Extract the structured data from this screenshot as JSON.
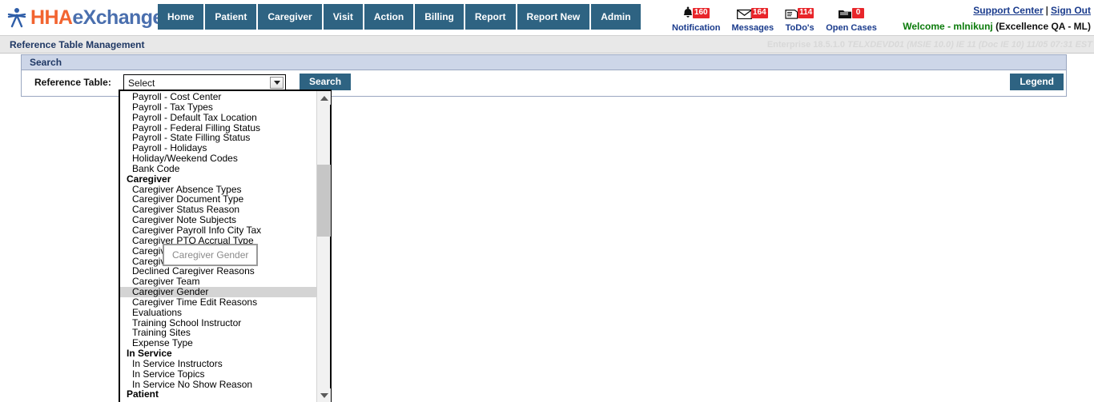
{
  "brand": {
    "logo_primary": "HHA",
    "logo_secondary": "eXchange",
    "color_orange": "#f26430",
    "color_blue": "#4a6fae"
  },
  "nav": {
    "items": [
      {
        "label": "Home",
        "name": "nav-home"
      },
      {
        "label": "Patient",
        "name": "nav-patient"
      },
      {
        "label": "Caregiver",
        "name": "nav-caregiver"
      },
      {
        "label": "Visit",
        "name": "nav-visit"
      },
      {
        "label": "Action",
        "name": "nav-action"
      },
      {
        "label": "Billing",
        "name": "nav-billing"
      },
      {
        "label": "Report",
        "name": "nav-report"
      },
      {
        "label": "Report New",
        "name": "nav-report-new"
      },
      {
        "label": "Admin",
        "name": "nav-admin"
      }
    ]
  },
  "alerts": [
    {
      "label": "Notification",
      "count": "160",
      "icon": "bell-icon",
      "glyph": "ὑ4"
    },
    {
      "label": "Messages",
      "count": "164",
      "icon": "envelope-icon",
      "glyph": "✉"
    },
    {
      "label": "ToDo's",
      "count": "114",
      "icon": "clipboard-icon",
      "glyph": "Ὕ2"
    },
    {
      "label": "Open Cases",
      "count": "0",
      "icon": "folder-icon",
      "glyph": "Ὄ1"
    }
  ],
  "topright": {
    "support_center": "Support Center",
    "separator": "|",
    "sign_out": "Sign Out",
    "welcome_user": "Welcome - mlnikunj",
    "welcome_org": "(Excellence QA - ML)"
  },
  "titlebar": {
    "page_title": "Reference Table Management",
    "enterprise_version": "Enterprise 18.5.1.0",
    "enterprise_env": "TELXDEVD01 (MSIE 10.0) IE 11 (Doc IE 10) 11/05 07:31 EST"
  },
  "search_panel": {
    "header": "Search",
    "field_label": "Reference Table:",
    "select_value": "Select",
    "search_button": "Search",
    "legend_button": "Legend"
  },
  "dropdown": {
    "selected_item": "Caregiver Gender",
    "tooltip_text": "Caregiver Gender",
    "options": [
      {
        "label": "Payroll - Cost Center",
        "type": "item"
      },
      {
        "label": "Payroll - Tax Types",
        "type": "item"
      },
      {
        "label": "Payroll - Default Tax Location",
        "type": "item"
      },
      {
        "label": "Payroll - Federal Filling Status",
        "type": "item"
      },
      {
        "label": "Payroll - State Filling Status",
        "type": "item"
      },
      {
        "label": "Payroll - Holidays",
        "type": "item"
      },
      {
        "label": "Holiday/Weekend Codes",
        "type": "item"
      },
      {
        "label": "Bank Code",
        "type": "item"
      },
      {
        "label": "Caregiver",
        "type": "group"
      },
      {
        "label": "Caregiver Absence Types",
        "type": "item"
      },
      {
        "label": "Caregiver Document Type",
        "type": "item"
      },
      {
        "label": "Caregiver Status Reason",
        "type": "item"
      },
      {
        "label": "Caregiver Note Subjects",
        "type": "item"
      },
      {
        "label": "Caregiver Payroll Info City Tax",
        "type": "item"
      },
      {
        "label": "Caregiver PTO Accrual Type",
        "type": "item"
      },
      {
        "label": "Caregiver",
        "type": "item"
      },
      {
        "label": "Caregiver",
        "type": "item"
      },
      {
        "label": "Declined Caregiver Reasons",
        "type": "item"
      },
      {
        "label": "Caregiver Team",
        "type": "item"
      },
      {
        "label": "Caregiver Gender",
        "type": "item",
        "selected": true
      },
      {
        "label": "Caregiver Time Edit Reasons",
        "type": "item"
      },
      {
        "label": "Evaluations",
        "type": "item"
      },
      {
        "label": "Training School Instructor",
        "type": "item"
      },
      {
        "label": "Training Sites",
        "type": "item"
      },
      {
        "label": "Expense Type",
        "type": "item"
      },
      {
        "label": "In Service",
        "type": "group"
      },
      {
        "label": "In Service Instructors",
        "type": "item"
      },
      {
        "label": "In Service Topics",
        "type": "item"
      },
      {
        "label": "In Service No Show Reason",
        "type": "item"
      },
      {
        "label": "Patient",
        "type": "group"
      }
    ]
  }
}
